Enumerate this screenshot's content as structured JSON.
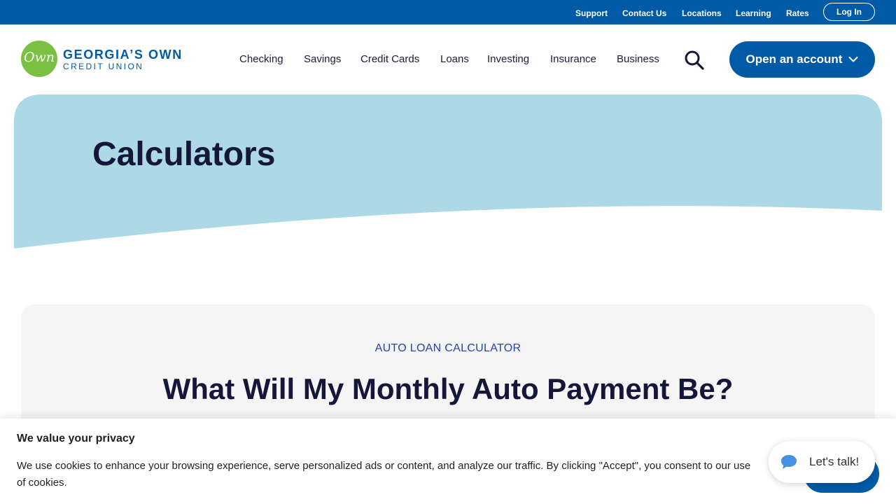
{
  "utility_nav": {
    "links": [
      "Support",
      "Contact Us",
      "Locations",
      "Learning",
      "Rates"
    ],
    "login_label": "Log In"
  },
  "logo": {
    "mark_text": "Own",
    "line1": "GEORGIA’S OWN",
    "line2": "CREDIT UNION"
  },
  "main_nav": {
    "items": [
      "Checking",
      "Savings",
      "Credit Cards",
      "Loans",
      "Investing",
      "Insurance",
      "Business"
    ],
    "cta_label": "Open an account"
  },
  "hero": {
    "title": "Calculators"
  },
  "calculator": {
    "eyebrow": "AUTO LOAN CALCULATOR",
    "heading": "What Will My Monthly Auto Payment Be?"
  },
  "cookie_banner": {
    "title": "We value your privacy",
    "text": "We use cookies to enhance your browsing experience, serve personalized ads or content, and analyze our traffic. By clicking \"Accept\", you consent to our use of cookies."
  },
  "chat": {
    "label": "Let's talk!"
  },
  "icons": {
    "search": "search-icon",
    "chevron": "chevron-down-icon",
    "chat": "chat-bubble-icon"
  },
  "colors": {
    "brand_blue": "#005aa6",
    "brand_green": "#7ac143",
    "hero_bg": "#add8e6",
    "navy_text": "#14163a",
    "eyebrow_blue": "#2643a5"
  }
}
